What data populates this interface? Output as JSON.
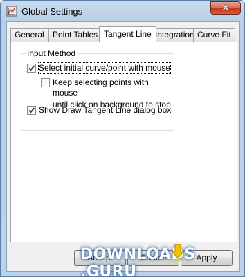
{
  "window": {
    "title": "Global Settings",
    "close_glyph": "✕"
  },
  "tabs": [
    {
      "label": "General",
      "active": false
    },
    {
      "label": "Point Tables",
      "active": false
    },
    {
      "label": "Tangent Line",
      "active": true
    },
    {
      "label": "Integration",
      "active": false
    },
    {
      "label": "Curve Fit",
      "active": false
    }
  ],
  "group": {
    "legend": "Input Method",
    "options": [
      {
        "label": "Select initial curve/point with mouse",
        "checked": true
      },
      {
        "label_line1": "Keep selecting points with mouse",
        "label_line2": "until click on background to stop",
        "checked": false
      },
      {
        "label": "Show Draw Tangent Line dialog box",
        "checked": true
      }
    ]
  },
  "buttons": {
    "ok": "Accept",
    "cancel": "Cancel",
    "apply": "Apply"
  },
  "watermark": {
    "text": "DOWNLOADS",
    "suffix": ".GURU"
  }
}
